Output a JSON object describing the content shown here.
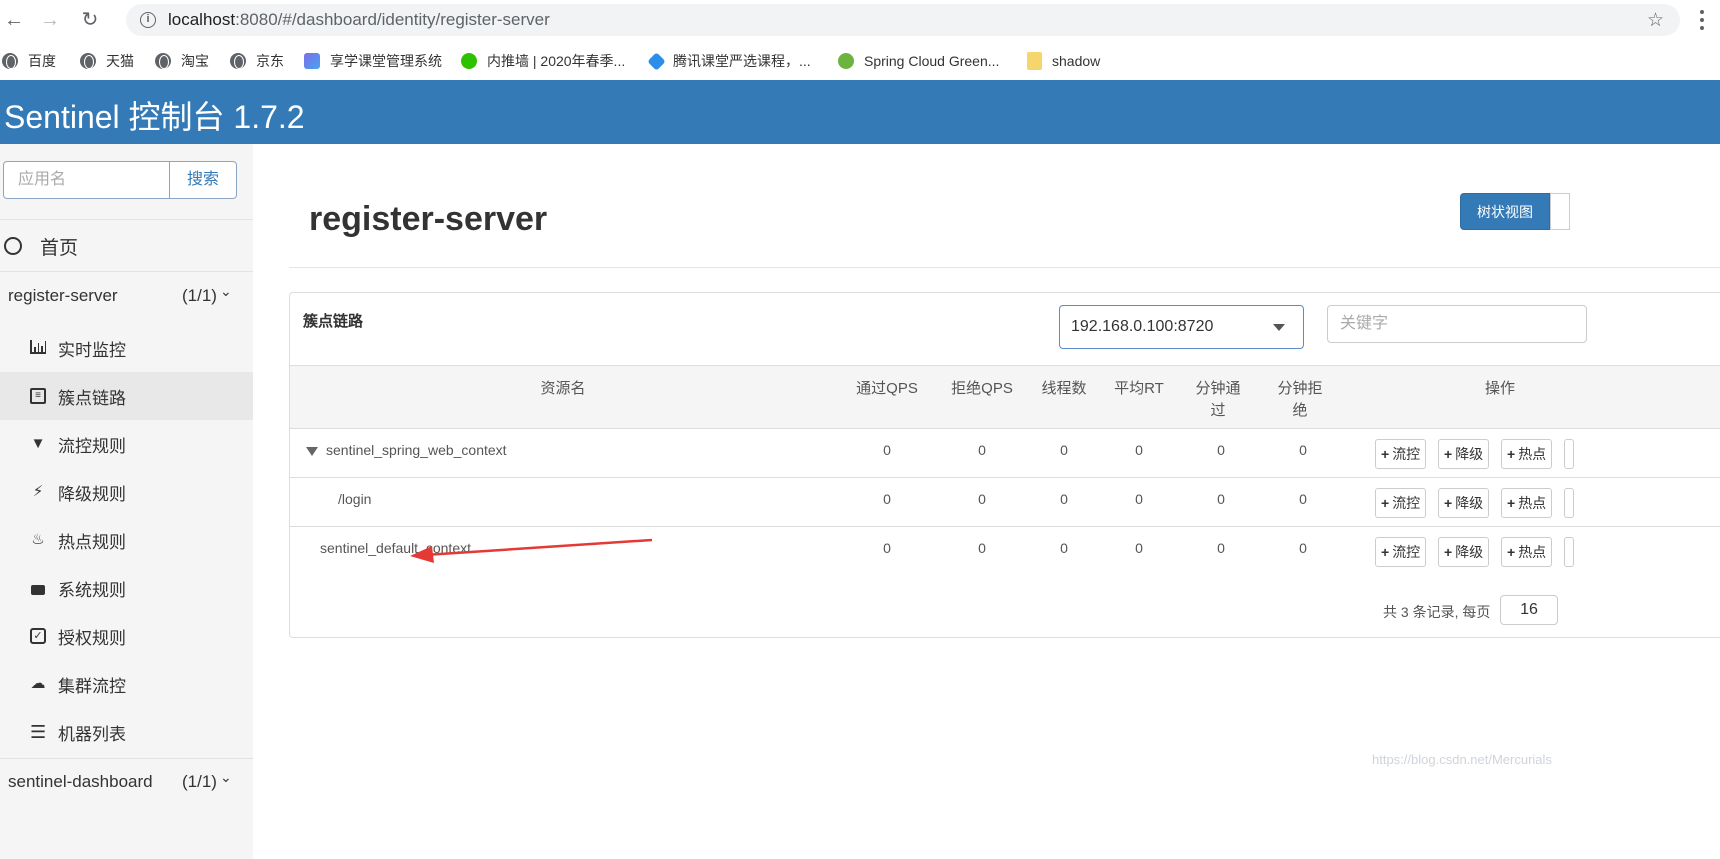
{
  "browser": {
    "url_host": "localhost",
    "url_rest": ":8080/#/dashboard/identity/register-server",
    "bookmarks": [
      "百度",
      "天猫",
      "淘宝",
      "京东",
      "享学课堂管理系统",
      "内推墙 | 2020年春季...",
      "腾讯课堂严选课程，...",
      "Spring Cloud Green...",
      "shadow"
    ]
  },
  "header": {
    "title": "Sentinel 控制台 1.7.2"
  },
  "sidebar": {
    "search_placeholder": "应用名",
    "search_button": "搜索",
    "home": "首页",
    "app": {
      "name": "register-server",
      "count": "(1/1)"
    },
    "items": [
      "实时监控",
      "簇点链路",
      "流控规则",
      "降级规则",
      "热点规则",
      "系统规则",
      "授权规则",
      "集群流控",
      "机器列表"
    ],
    "app2": {
      "name": "sentinel-dashboard",
      "count": "(1/1)"
    }
  },
  "main": {
    "title": "register-server",
    "view_tree": "树状视图",
    "panel_title": "簇点链路",
    "machine": "192.168.0.100:8720",
    "keyword_placeholder": "关键字",
    "columns": [
      "资源名",
      "通过QPS",
      "拒绝QPS",
      "线程数",
      "平均RT",
      "分钟通过",
      "分钟拒绝",
      "操作"
    ],
    "rows": [
      {
        "name": "sentinel_spring_web_context",
        "values": [
          "0",
          "0",
          "0",
          "0",
          "0",
          "0"
        ]
      },
      {
        "name": "/login",
        "values": [
          "0",
          "0",
          "0",
          "0",
          "0",
          "0"
        ]
      },
      {
        "name": "sentinel_default_context",
        "values": [
          "0",
          "0",
          "0",
          "0",
          "0",
          "0"
        ]
      }
    ],
    "actions": [
      "流控",
      "降级",
      "热点"
    ],
    "pager_text": "共 3 条记录, 每页",
    "page_size": "16"
  },
  "watermark": "https://blog.csdn.net/Mercurials",
  "colors": {
    "brand": "#337ab7",
    "annotation_arrow": "#e53935"
  }
}
